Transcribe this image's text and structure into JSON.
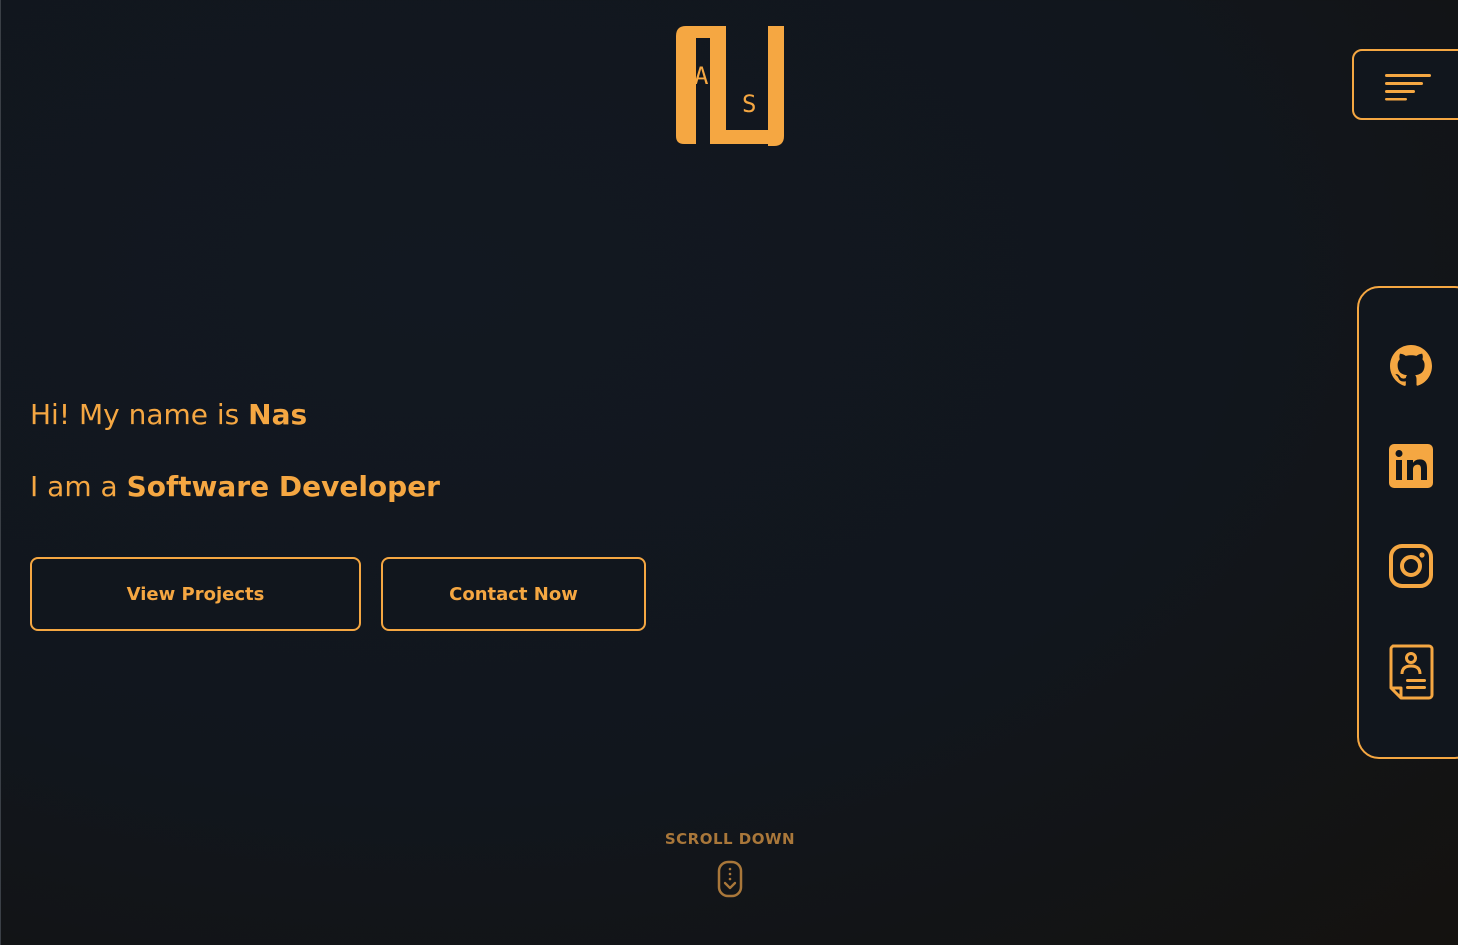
{
  "logo": {
    "letters": [
      "A",
      "S"
    ],
    "name": "logo"
  },
  "menu": {
    "icon": "menu-icon"
  },
  "hero": {
    "greeting_prefix": "Hi! My name is ",
    "name": "Nas",
    "role_prefix": "I am a ",
    "role": "Software Developer"
  },
  "buttons": {
    "projects": "View Projects",
    "contact": "Contact Now"
  },
  "social": [
    {
      "name": "github",
      "icon": "github-icon"
    },
    {
      "name": "linkedin",
      "icon": "linkedin-icon"
    },
    {
      "name": "instagram",
      "icon": "instagram-icon"
    },
    {
      "name": "resume",
      "icon": "resume-icon"
    }
  ],
  "scroll": {
    "label": "SCROLL DOWN",
    "icon": "mouse-scroll-icon"
  },
  "colors": {
    "accent": "#f5a742",
    "background": "#11161d",
    "muted": "#a9773a"
  }
}
